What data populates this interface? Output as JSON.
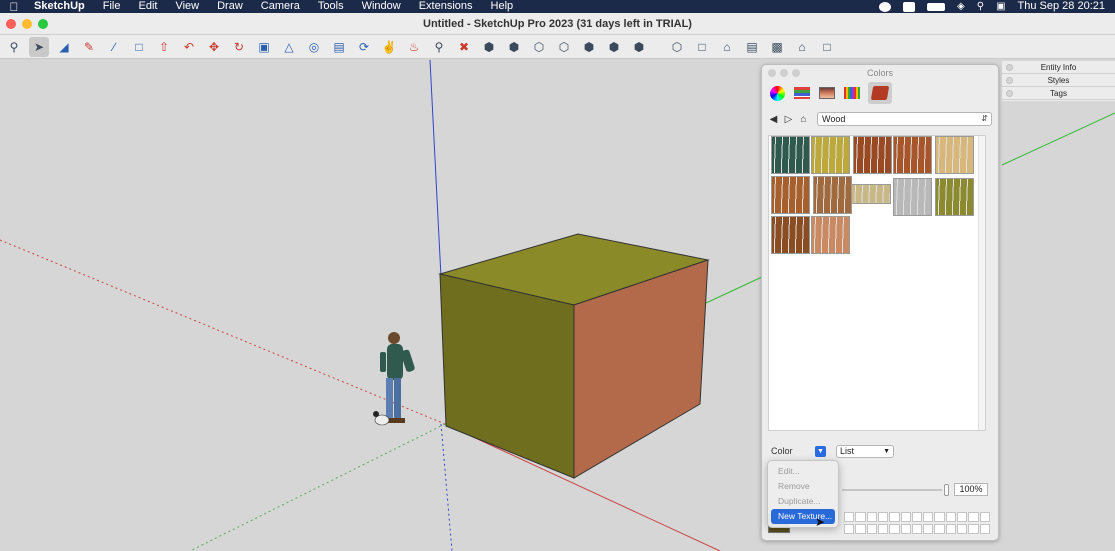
{
  "menubar": {
    "app_name": "SketchUp",
    "items": [
      "File",
      "Edit",
      "View",
      "Draw",
      "Camera",
      "Tools",
      "Window",
      "Extensions",
      "Help"
    ],
    "datetime": "Thu Sep 28  20:21"
  },
  "window": {
    "title": "Untitled - SketchUp Pro 2023 (31 days left in TRIAL)"
  },
  "toolbar": {
    "tools": [
      "search-icon",
      "select-icon",
      "eraser-icon",
      "pencil-icon",
      "line-icon",
      "rectangle-icon",
      "pushpull-icon",
      "offset-icon",
      "move-icon",
      "rotate-icon",
      "scale-icon",
      "tape-icon",
      "paint-icon",
      "orbit-icon",
      "pan-icon",
      "zoom-icon",
      "zoom-extents-icon",
      "views-icon"
    ]
  },
  "colors_panel": {
    "title": "Colors",
    "library": "Wood",
    "swatches": [
      {
        "name": "wood-swatch-teal",
        "color": "#2f5a4d"
      },
      {
        "name": "wood-swatch-yellow",
        "color": "#bda83a"
      },
      {
        "name": "wood-swatch-cherry",
        "color": "#9a4a22"
      },
      {
        "name": "wood-swatch-plank",
        "color": "#a8552a"
      },
      {
        "name": "wood-swatch-light",
        "color": "#d8b77a"
      },
      {
        "name": "wood-swatch-amber",
        "color": "#a7602b"
      },
      {
        "name": "wood-swatch-oak",
        "color": "#a06a3e"
      },
      {
        "name": "wood-swatch-veneer",
        "color": "#c8b888"
      },
      {
        "name": "wood-swatch-grey",
        "color": "#b8b8b8"
      },
      {
        "name": "wood-swatch-olive",
        "color": "#8c8a2e"
      },
      {
        "name": "wood-swatch-brown",
        "color": "#8a4e22"
      },
      {
        "name": "wood-swatch-salmon",
        "color": "#c98a62"
      }
    ],
    "pick_mode": "Color",
    "view_mode": "List",
    "opacity": "100%"
  },
  "popup_menu": {
    "items": [
      "Edit...",
      "Remove",
      "Duplicate...",
      "New Texture..."
    ],
    "active_index": 3
  },
  "tray": {
    "items": [
      "Entity Info",
      "Styles",
      "Tags"
    ]
  },
  "colors": {
    "box_top": "#8a8a28",
    "box_left": "#6f6d1e",
    "box_right": "#b36a4a"
  }
}
